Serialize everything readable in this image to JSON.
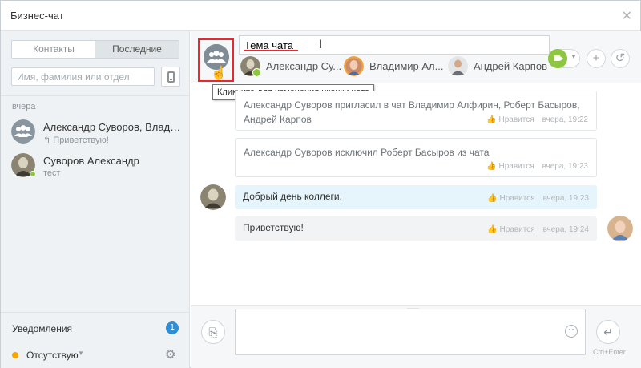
{
  "window": {
    "title": "Бизнес-чат"
  },
  "left": {
    "tabs": [
      {
        "label": "Контакты",
        "active": false
      },
      {
        "label": "Последние",
        "active": true
      }
    ],
    "search": {
      "placeholder": "Имя, фамилия или отдел",
      "value": ""
    },
    "group_label": "вчера",
    "chats": [
      {
        "name": "Александр Суворов, Влади...",
        "preview": "Приветствую!",
        "icon": "group-icon"
      },
      {
        "name": "Суворов Александр",
        "preview": "тест",
        "icon": "user-avatar"
      }
    ],
    "notifications": {
      "label": "Уведомления",
      "count": "1"
    },
    "status": {
      "label": "Отсутствую",
      "color": "#f7a700"
    }
  },
  "header": {
    "topic": "Тема чата",
    "tooltip": "Кликните для изменения иконки чата",
    "members": [
      {
        "name": "Александр Су..."
      },
      {
        "name": "Владимир Ал..."
      },
      {
        "name": "Андрей Карпов"
      }
    ]
  },
  "messages": [
    {
      "type": "system",
      "text": "Александр Суворов пригласил в чат Владимир Алфирин, Роберт Басыров, Андрей Карпов",
      "like": "Нравится",
      "time": "вчера, 19:22"
    },
    {
      "type": "system",
      "text": "Александр Суворов исключил Роберт Басыров из чата",
      "like": "Нравится",
      "time": "вчера, 19:23"
    },
    {
      "type": "incoming",
      "text": "Добрый день коллеги.",
      "like": "Нравится",
      "time": "вчера, 19:23"
    },
    {
      "type": "outgoing",
      "text": "Приветствую!",
      "like": "Нравится",
      "time": "вчера, 19:24"
    }
  ],
  "footer": {
    "send_hint": "Ctrl+Enter",
    "input_value": ""
  },
  "colors": {
    "accent_blue": "#2f8fd6",
    "online_green": "#8dc63f",
    "highlight_red": "#e8282e",
    "incoming_bg": "#e6f4fb"
  }
}
